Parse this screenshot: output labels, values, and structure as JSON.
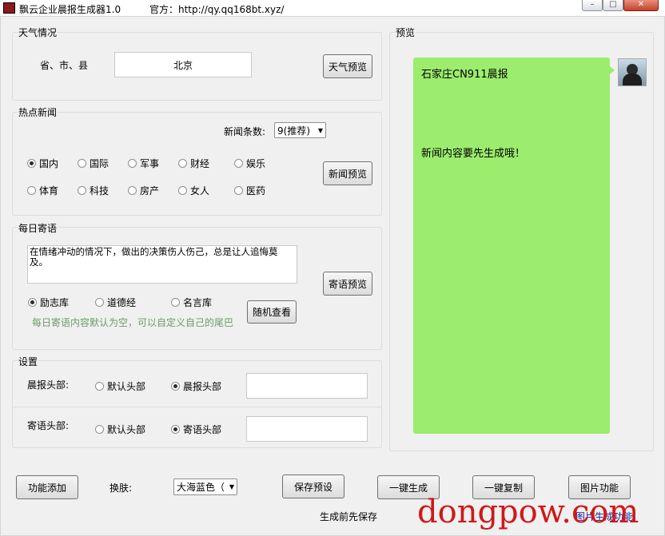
{
  "window": {
    "title": "飘云企业晨报生成器1.0",
    "site": "官方：http://qy.qq168bt.xyz/",
    "min_label": "–",
    "max_label": "□",
    "close_label": "✕"
  },
  "weather": {
    "group_label": "天气情况",
    "province_label": "省、市、县",
    "city_value": "北京",
    "preview_button": "天气预览"
  },
  "news": {
    "group_label": "热点新闻",
    "count_label": "新闻条数:",
    "count_value": "9(推荐)",
    "categories": [
      {
        "label": "国内",
        "checked": true
      },
      {
        "label": "国际",
        "checked": false
      },
      {
        "label": "军事",
        "checked": false
      },
      {
        "label": "财经",
        "checked": false
      },
      {
        "label": "娱乐",
        "checked": false
      },
      {
        "label": "体育",
        "checked": false
      },
      {
        "label": "科技",
        "checked": false
      },
      {
        "label": "房产",
        "checked": false
      },
      {
        "label": "女人",
        "checked": false
      },
      {
        "label": "医药",
        "checked": false
      }
    ],
    "preview_button": "新闻预览"
  },
  "quote": {
    "group_label": "每日寄语",
    "text": "在情绪冲动的情况下，做出的决策伤人伤己，总是让人追悔莫及。",
    "sources": [
      {
        "label": "励志库",
        "checked": true
      },
      {
        "label": "道德经",
        "checked": false
      },
      {
        "label": "名言库",
        "checked": false
      }
    ],
    "random_button": "随机查看",
    "hint": "每日寄语内容默认为空，可以自定义自己的尾巴",
    "preview_button": "寄语预览"
  },
  "settings": {
    "group_label": "设置",
    "header_label": "晨报头部:",
    "header_options": [
      {
        "label": "默认头部",
        "checked": false
      },
      {
        "label": "晨报头部",
        "checked": true
      }
    ],
    "header_value": "",
    "quote_header_label": "寄语头部:",
    "quote_header_options": [
      {
        "label": "默认头部",
        "checked": false
      },
      {
        "label": "寄语头部",
        "checked": true
      }
    ],
    "quote_header_value": ""
  },
  "preview": {
    "group_label": "预览",
    "title_line": "石家庄CN911晨报",
    "body_line": "新闻内容要先生成哦！",
    "bubble_color": "#9cec6e"
  },
  "footer": {
    "feature_add": "功能添加",
    "skin_label": "换肤:",
    "skin_value": "大海蓝色（",
    "save_preset": "保存预设",
    "generate": "一键生成",
    "copy": "一键复制",
    "image_feature": "图片功能",
    "save_hint": "生成前先保存",
    "image_hint": "图片生成功能",
    "watermark": "dongpow.com"
  }
}
